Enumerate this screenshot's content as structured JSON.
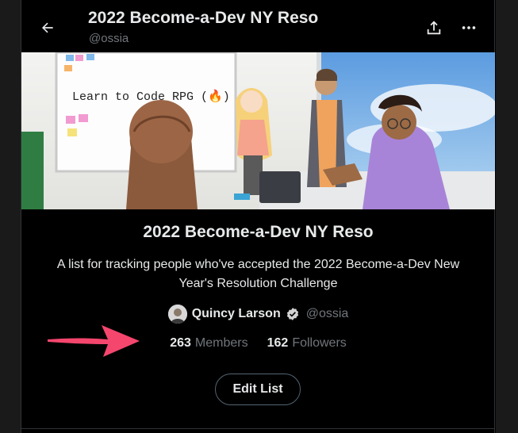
{
  "header": {
    "title": "2022 Become-a-Dev NY Reso",
    "handle": "@ossia"
  },
  "icons": {
    "back": "back-arrow-icon",
    "share": "share-icon",
    "more": "more-options-icon",
    "verified": "verified-badge-icon"
  },
  "banner": {
    "whiteboard_text": "Learn to Code RPG (🔥)"
  },
  "list": {
    "title": "2022 Become-a-Dev NY Reso",
    "description": "A list for tracking people who've accepted the 2022 Become-a-Dev New Year's Resolution Challenge"
  },
  "owner": {
    "name": "Quincy Larson",
    "handle": "@ossia"
  },
  "stats": {
    "members_count": "263",
    "members_label": "Members",
    "followers_count": "162",
    "followers_label": "Followers"
  },
  "actions": {
    "edit_label": "Edit List"
  },
  "colors": {
    "background": "#000000",
    "text_primary": "#e7e9ea",
    "text_secondary": "#71767b",
    "annotation_arrow": "#f5466e"
  }
}
